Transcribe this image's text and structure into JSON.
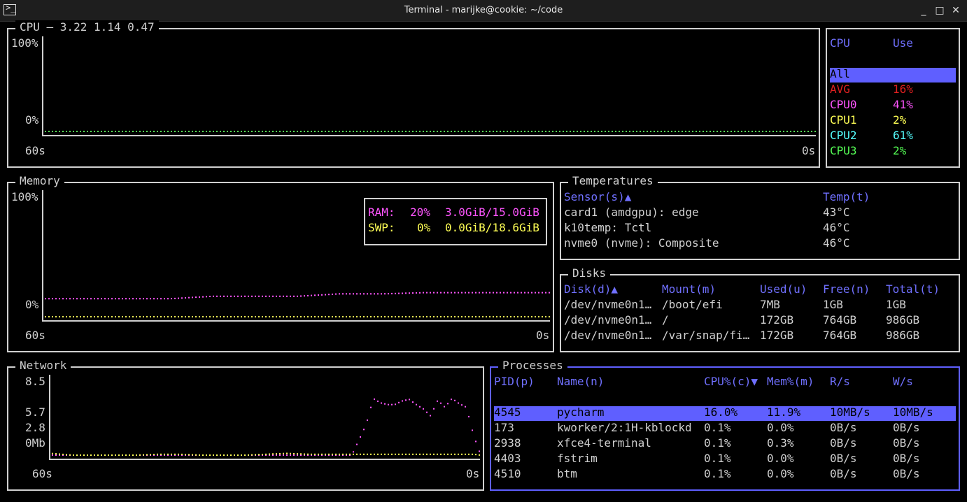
{
  "window": {
    "title": "Terminal - marijke@cookie: ~/code",
    "terminal_icon": ">_",
    "minimize": "_",
    "maximize": "□",
    "close": "✕"
  },
  "colors": {
    "avg": "#e02020",
    "cpu0": "#ff55ff",
    "cpu1": "#ffff55",
    "cpu2": "#55ffff",
    "cpu3": "#55ff55",
    "accent": "#5f5fff",
    "ram": "#ff55ff",
    "swp": "#ffff55"
  },
  "cpu": {
    "title": "CPU — 3.22 1.14 0.47",
    "y_max": "100%",
    "y_min": "0%",
    "x_left": "60s",
    "x_right": "0s",
    "legend_header": {
      "cpu": "CPU",
      "use": "Use"
    },
    "legend_rows": [
      {
        "name": "All",
        "use": ""
      },
      {
        "name": "AVG",
        "use": "16%"
      },
      {
        "name": "CPU0",
        "use": "41%"
      },
      {
        "name": "CPU1",
        "use": "2%"
      },
      {
        "name": "CPU2",
        "use": "61%"
      },
      {
        "name": "CPU3",
        "use": "2%"
      }
    ]
  },
  "memory": {
    "title": "Memory",
    "y_max": "100%",
    "y_min": "0%",
    "x_left": "60s",
    "x_right": "0s",
    "ram_label": "RAM:",
    "ram_pct": "20%",
    "ram_usage": "3.0GiB/15.0GiB",
    "swp_label": "SWP:",
    "swp_pct": "0%",
    "swp_usage": "0.0GiB/18.6GiB"
  },
  "temperatures": {
    "title": "Temperatures",
    "headers": {
      "sensor": "Sensor(s)▲",
      "temp": "Temp(t)"
    },
    "rows": [
      {
        "sensor": "card1 (amdgpu): edge",
        "temp": "43°C"
      },
      {
        "sensor": "k10temp: Tctl",
        "temp": "46°C"
      },
      {
        "sensor": "nvme0 (nvme): Composite",
        "temp": "46°C"
      }
    ]
  },
  "disks": {
    "title": "Disks",
    "headers": {
      "disk": "Disk(d)▲",
      "mount": "Mount(m)",
      "used": "Used(u)",
      "free": "Free(n)",
      "total": "Total(t)"
    },
    "rows": [
      {
        "disk": "/dev/nvme0n1…",
        "mount": "/boot/efi",
        "used": "7MB",
        "free": "1GB",
        "total": "1GB"
      },
      {
        "disk": "/dev/nvme0n1…",
        "mount": "/",
        "used": "172GB",
        "free": "764GB",
        "total": "986GB"
      },
      {
        "disk": "/dev/nvme0n1…",
        "mount": "/var/snap/fi…",
        "used": "172GB",
        "free": "764GB",
        "total": "986GB"
      }
    ]
  },
  "network": {
    "title": "Network",
    "y_ticks": [
      "8.5",
      "5.7",
      "2.8",
      "0Mb"
    ],
    "x_left": "60s",
    "x_right": "0s"
  },
  "processes": {
    "title": "Processes",
    "headers": {
      "pid": "PID(p)",
      "name": "Name(n)",
      "cpu": "CPU%(c)▼",
      "mem": "Mem%(m)",
      "rs": "R/s",
      "ws": "W/s"
    },
    "rows": [
      {
        "pid": "4545",
        "name": "pycharm",
        "cpu": "16.0%",
        "mem": "11.9%",
        "rs": "10MB/s",
        "ws": "10MB/s"
      },
      {
        "pid": "173",
        "name": "kworker/2:1H-kblockd",
        "cpu": "0.1%",
        "mem": "0.0%",
        "rs": "0B/s",
        "ws": "0B/s"
      },
      {
        "pid": "2938",
        "name": "xfce4-terminal",
        "cpu": "0.1%",
        "mem": "0.3%",
        "rs": "0B/s",
        "ws": "0B/s"
      },
      {
        "pid": "4403",
        "name": "fstrim",
        "cpu": "0.1%",
        "mem": "0.0%",
        "rs": "0B/s",
        "ws": "0B/s"
      },
      {
        "pid": "4510",
        "name": "btm",
        "cpu": "0.1%",
        "mem": "0.0%",
        "rs": "0B/s",
        "ws": "0B/s"
      }
    ]
  },
  "chart_data": [
    {
      "type": "line",
      "title": "CPU — 3.22 1.14 0.47",
      "xlabel": "",
      "ylabel": "",
      "x_ticks": [
        "60s",
        "0s"
      ],
      "ylim": [
        0,
        100
      ],
      "x": [
        60,
        58,
        56,
        54,
        52,
        50,
        48,
        46,
        44,
        42,
        40,
        38,
        36,
        34,
        32,
        30,
        28,
        26,
        24,
        22,
        20,
        18,
        16,
        14,
        12,
        10,
        8,
        6,
        4,
        2,
        0
      ],
      "series": [
        {
          "name": "AVG",
          "values": [
            0,
            0,
            0,
            0,
            0,
            0,
            0,
            0,
            0,
            0,
            0,
            0,
            0,
            0,
            0,
            0,
            0,
            0,
            0,
            0,
            0,
            0,
            0,
            0,
            0,
            0,
            0,
            0,
            0,
            0,
            0
          ]
        },
        {
          "name": "CPU0",
          "values": [
            0,
            0,
            0,
            0,
            0,
            0,
            0,
            0,
            0,
            0,
            0,
            0,
            0,
            0,
            0,
            0,
            0,
            0,
            0,
            0,
            0,
            0,
            0,
            0,
            0,
            0,
            0,
            0,
            0,
            0,
            0
          ]
        },
        {
          "name": "CPU1",
          "values": [
            0,
            0,
            0,
            0,
            0,
            0,
            0,
            0,
            0,
            0,
            0,
            0,
            0,
            0,
            0,
            0,
            0,
            0,
            0,
            0,
            0,
            0,
            0,
            0,
            0,
            0,
            0,
            0,
            0,
            0,
            0
          ]
        },
        {
          "name": "CPU2",
          "values": [
            0,
            0,
            0,
            0,
            0,
            0,
            0,
            0,
            0,
            0,
            0,
            0,
            0,
            0,
            0,
            0,
            0,
            0,
            0,
            0,
            0,
            0,
            0,
            0,
            0,
            0,
            0,
            0,
            0,
            0,
            0
          ]
        },
        {
          "name": "CPU3",
          "values": [
            0,
            0,
            0,
            0,
            0,
            0,
            0,
            0,
            0,
            0,
            0,
            0,
            0,
            0,
            0,
            0,
            0,
            0,
            0,
            0,
            0,
            0,
            0,
            0,
            0,
            0,
            0,
            0,
            0,
            0,
            0
          ]
        }
      ]
    },
    {
      "type": "line",
      "title": "Memory",
      "xlabel": "",
      "ylabel": "",
      "x_ticks": [
        "60s",
        "0s"
      ],
      "ylim": [
        0,
        100
      ],
      "x": [
        60,
        55,
        50,
        45,
        40,
        35,
        30,
        25,
        20,
        15,
        10,
        5,
        0
      ],
      "series": [
        {
          "name": "RAM",
          "values": [
            15,
            15,
            15,
            15,
            17,
            17,
            17,
            19,
            19,
            20,
            20,
            20,
            20
          ]
        },
        {
          "name": "SWP",
          "values": [
            0,
            0,
            0,
            0,
            0,
            0,
            0,
            0,
            0,
            0,
            0,
            0,
            0
          ]
        }
      ]
    },
    {
      "type": "line",
      "title": "Network",
      "xlabel": "",
      "ylabel": "",
      "x_ticks": [
        "60s",
        "0s"
      ],
      "y_ticks": [
        0,
        2.8,
        5.7,
        8.5
      ],
      "ylim": [
        0,
        8.5
      ],
      "x": [
        60,
        57,
        54,
        51,
        48,
        45,
        42,
        39,
        36,
        33,
        30,
        27,
        24,
        21,
        18,
        16,
        15,
        14,
        13,
        12,
        11,
        10,
        9,
        8,
        7,
        6,
        5,
        4,
        3,
        2,
        1,
        0
      ],
      "series": [
        {
          "name": "RX",
          "values": [
            0,
            0,
            0,
            0,
            0,
            0,
            0,
            0,
            0,
            0,
            0,
            0,
            0,
            0,
            0,
            3.5,
            6.5,
            6,
            5.8,
            5.8,
            6.2,
            6.4,
            5.8,
            5.3,
            4.5,
            6.3,
            5.5,
            6.5,
            5.9,
            5.5,
            2.3,
            0
          ]
        },
        {
          "name": "TX",
          "values": [
            0.2,
            0,
            0,
            0,
            0,
            0.1,
            0.1,
            0,
            0,
            0,
            0.1,
            0.2,
            0.1,
            0.1,
            0.1,
            0.1,
            0.1,
            0.1,
            0.1,
            0.1,
            0.1,
            0.1,
            0.1,
            0.1,
            0.1,
            0.1,
            0.1,
            0.1,
            0.1,
            0.1,
            0.1,
            0
          ]
        }
      ]
    }
  ]
}
